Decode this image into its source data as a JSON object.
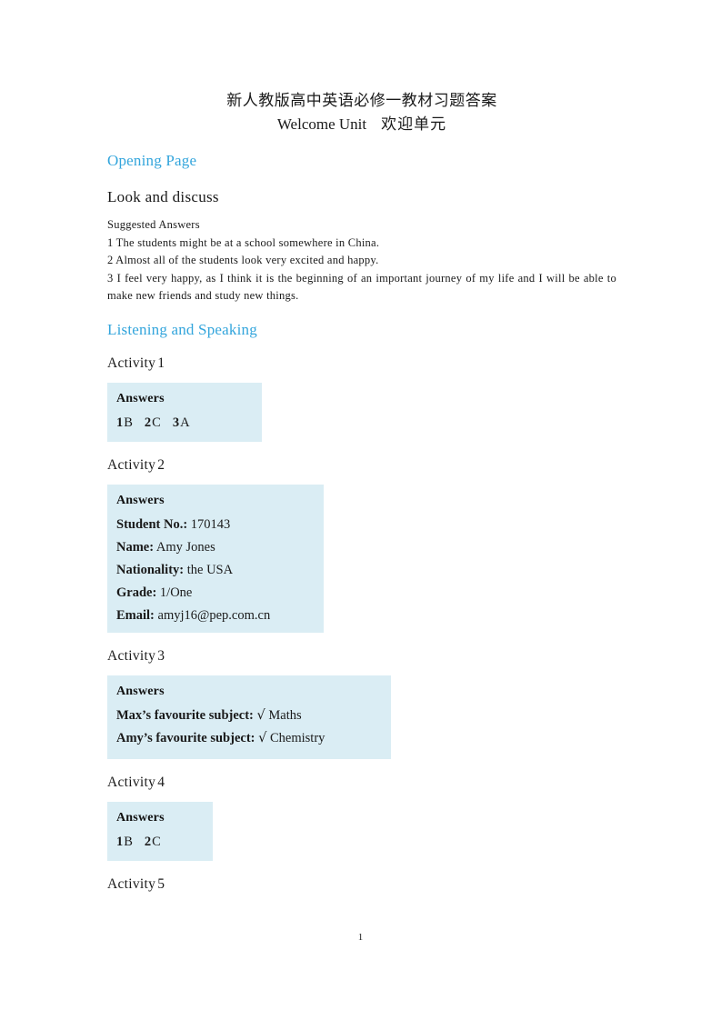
{
  "document": {
    "title": "新人教版高中英语必修一教材习题答案",
    "subtitle_en": "Welcome Unit",
    "subtitle_cn": "欢迎单元",
    "page_number": "1"
  },
  "sections": {
    "opening_page": {
      "heading": "Opening Page",
      "sub_heading": "Look and  discuss",
      "suggested_answers_label": "Suggested  Answers",
      "lines": [
        "1 The students  might  be at a school  somewhere  in China.",
        "2 Almost all of the  students  look very excited  and  happy.",
        "3 I feel very happy,  as I think it is the  beginning  of an important  journey  of my life and  I will be  able  to  make  new  friends  and  study  new things."
      ]
    },
    "listening_and_speaking": {
      "heading": "Listening  and  Speaking",
      "activities": [
        {
          "label": "Activity",
          "number": "1",
          "answers_title": "Answers",
          "options": [
            {
              "num": "1",
              "value": "B"
            },
            {
              "num": "2",
              "value": "C"
            },
            {
              "num": "3",
              "value": "A"
            }
          ]
        },
        {
          "label": "Activity",
          "number": "2",
          "answers_title": "Answers",
          "fields": [
            {
              "key": "Student No.:",
              "value": "170143"
            },
            {
              "key": "Name:",
              "value": "Amy Jones"
            },
            {
              "key": "Nationality:",
              "value": "the USA"
            },
            {
              "key": "Grade:",
              "value": "1/One"
            },
            {
              "key": "Email:",
              "value": "amyj16@pep.com.cn"
            }
          ]
        },
        {
          "label": "Activity",
          "number": "3",
          "answers_title": "Answers",
          "subjects": [
            {
              "key": "Max’s favourite subject:",
              "tick": "√",
              "value": "Maths"
            },
            {
              "key": "Amy’s favourite subject:",
              "tick": "√",
              "value": "Chemistry"
            }
          ]
        },
        {
          "label": "Activity",
          "number": "4",
          "answers_title": "Answers",
          "options": [
            {
              "num": "1",
              "value": "B"
            },
            {
              "num": "2",
              "value": "C"
            }
          ]
        },
        {
          "label": "Activity",
          "number": "5"
        }
      ]
    }
  },
  "colors": {
    "heading_blue": "#33a5dc",
    "answer_box_bg": "#daedf4",
    "text": "#1a1a1a"
  }
}
